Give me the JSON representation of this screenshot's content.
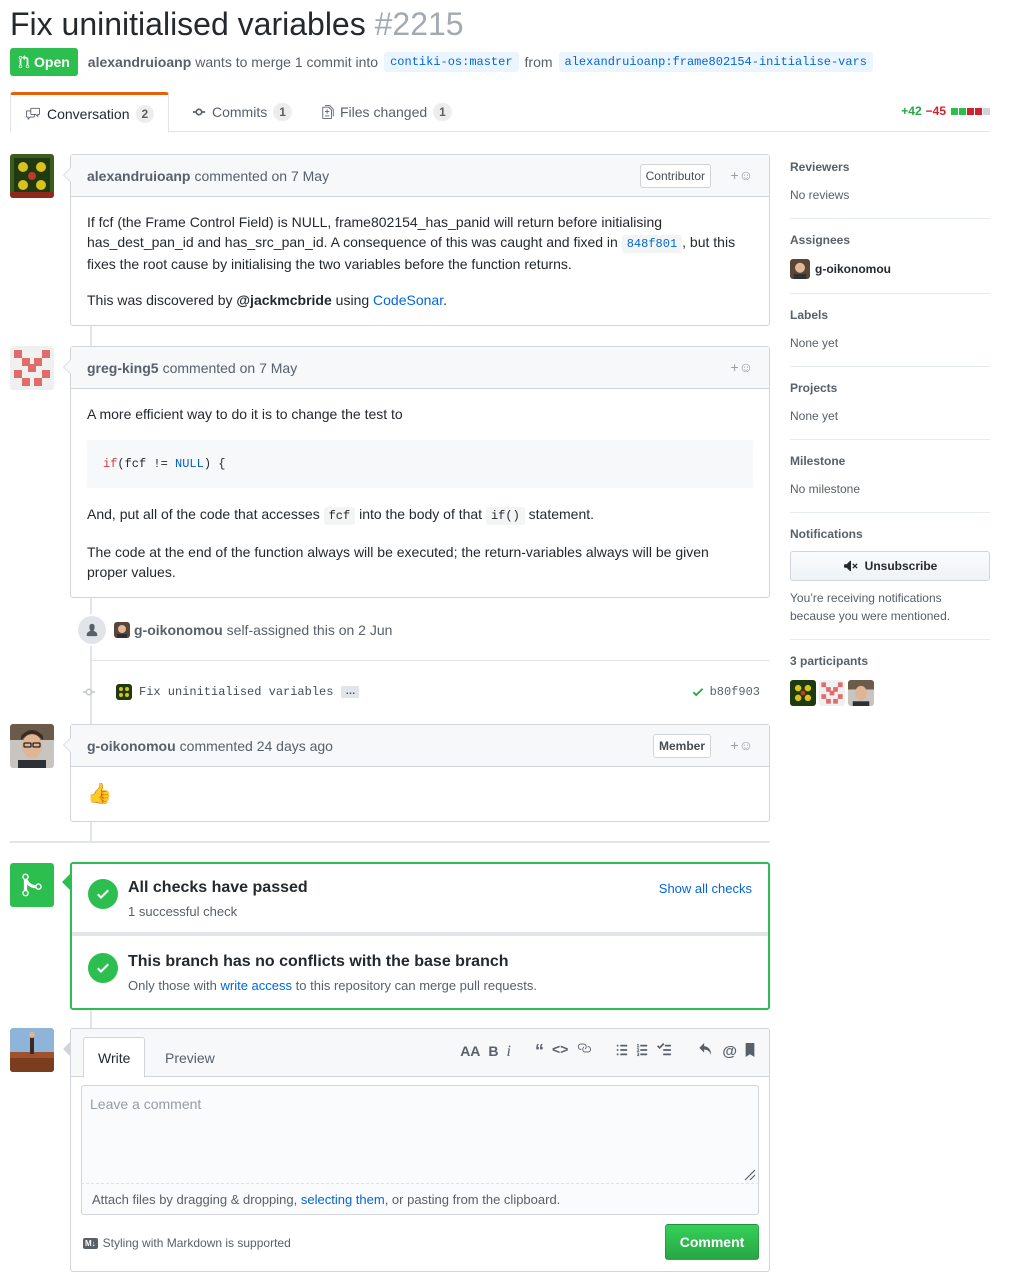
{
  "pr": {
    "title": "Fix uninitialised variables",
    "number": "#2215",
    "state": "Open",
    "author": "alexandruioanp",
    "merge_text": "wants to merge 1 commit into",
    "base_branch": "contiki-os:master",
    "from_text": "from",
    "head_branch": "alexandruioanp:frame802154-initialise-vars"
  },
  "tabs": [
    {
      "label": "Conversation",
      "count": "2"
    },
    {
      "label": "Commits",
      "count": "1"
    },
    {
      "label": "Files changed",
      "count": "1"
    }
  ],
  "diffstat": {
    "additions": "+42",
    "deletions": "−45"
  },
  "comments": [
    {
      "author": "alexandruioanp",
      "action": "commented on 7 May",
      "role": "Contributor",
      "p1_a": "If fcf (the Frame Control Field) is NULL, frame802154_has_panid will return before initialising has_dest_pan_id and has_src_pan_id. A consequence of this was caught and fixed in",
      "sha": "848f801",
      "p1_b": ", but this fixes the root cause by initialising the two variables before the function returns.",
      "p2_a": "This was discovered by",
      "mention": "@jackmcbride",
      "p2_b": "using",
      "link": "CodeSonar",
      "p2_c": "."
    },
    {
      "author": "greg-king5",
      "action": "commented on 7 May",
      "p1": "A more efficient way to do it is to change the test to",
      "code_kw": "if",
      "code_mid": "(fcf != ",
      "code_const": "NULL",
      "code_end": ") {",
      "p2_a": "And, put all of the code that accesses",
      "code_fcf": "fcf",
      "p2_b": "into the body of that",
      "code_if": "if()",
      "p2_c": "statement.",
      "p3": "The code at the end of the function always will be executed; the return-variables always will be given proper values."
    },
    {
      "author": "g-oikonomou",
      "action": "commented 24 days ago",
      "role": "Member",
      "body": "👍"
    }
  ],
  "events": {
    "assign_user": "g-oikonomou",
    "assign_text": "self-assigned this on 2 Jun",
    "commit_msg": "Fix uninitialised variables",
    "commit_more": "…",
    "commit_sha": "b80f903"
  },
  "merge": {
    "checks_title": "All checks have passed",
    "checks_sub": "1 successful check",
    "show_all": "Show all checks",
    "branch_title": "This branch has no conflicts with the base branch",
    "branch_sub_a": "Only those with",
    "branch_sub_link": "write access",
    "branch_sub_b": "to this repository can merge pull requests."
  },
  "composer": {
    "tab_write": "Write",
    "tab_preview": "Preview",
    "placeholder": "Leave a comment",
    "attach_a": "Attach files by dragging & dropping,",
    "attach_link": "selecting them",
    "attach_b": ", or pasting from the clipboard.",
    "md_note": "Styling with Markdown is supported",
    "submit": "Comment",
    "toolbar": [
      "AA",
      "B",
      "i",
      "“",
      "<>",
      "link",
      "ul",
      "ol",
      "task",
      "reply",
      "@",
      "bookmark"
    ]
  },
  "sidebar": {
    "reviewers_h": "Reviewers",
    "reviewers_v": "No reviews",
    "assignees_h": "Assignees",
    "assignee": "g-oikonomou",
    "labels_h": "Labels",
    "labels_v": "None yet",
    "projects_h": "Projects",
    "projects_v": "None yet",
    "milestone_h": "Milestone",
    "milestone_v": "No milestone",
    "notifications_h": "Notifications",
    "unsubscribe": "Unsubscribe",
    "notif_reason": "You’re receiving notifications because you were mentioned.",
    "participants_h": "3 participants"
  },
  "colors": {
    "open_green": "#2cbe4e",
    "link_blue": "#0366d6",
    "diff_add": "#28a745",
    "diff_del": "#cb2431"
  }
}
